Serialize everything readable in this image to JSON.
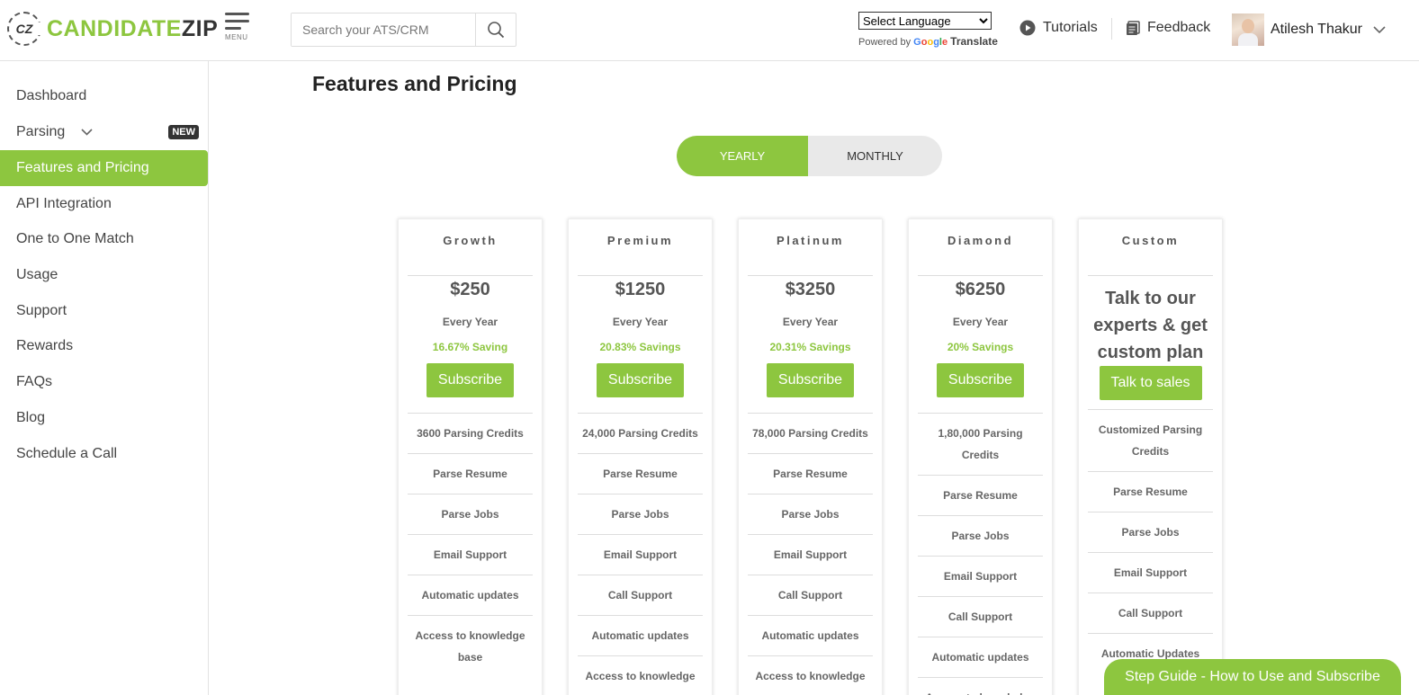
{
  "header": {
    "logo_text_1": "CANDIDATE",
    "logo_text_2": "ZIP",
    "logo_mark": "CZ",
    "menu_label": "MENU",
    "search_placeholder": "Search your ATS/CRM",
    "language_select": "Select Language",
    "powered_by": "Powered by",
    "google": "Google",
    "translate": "Translate",
    "tutorials": "Tutorials",
    "feedback": "Feedback",
    "user_name": "Atilesh Thakur"
  },
  "sidebar": {
    "items": [
      {
        "label": "Dashboard"
      },
      {
        "label": "Parsing",
        "badge": "NEW"
      },
      {
        "label": "Features and Pricing"
      },
      {
        "label": "API Integration"
      },
      {
        "label": "One to One Match"
      },
      {
        "label": "Usage"
      },
      {
        "label": "Support"
      },
      {
        "label": "Rewards"
      },
      {
        "label": "FAQs"
      },
      {
        "label": "Blog"
      },
      {
        "label": "Schedule a Call"
      }
    ]
  },
  "main": {
    "title": "Features and Pricing",
    "toggle": {
      "yearly": "YEARLY",
      "monthly": "MONTHLY"
    },
    "plans": [
      {
        "name": "Growth",
        "price": "$250",
        "period": "Every Year",
        "saving": "16.67% Saving",
        "button": "Subscribe",
        "features": [
          "3600 Parsing Credits",
          "Parse Resume",
          "Parse Jobs",
          "Email Support",
          "Automatic updates",
          "Access to knowledge base"
        ]
      },
      {
        "name": "Premium",
        "price": "$1250",
        "period": "Every Year",
        "saving": "20.83% Savings",
        "button": "Subscribe",
        "features": [
          "24,000 Parsing Credits",
          "Parse Resume",
          "Parse Jobs",
          "Email Support",
          "Call Support",
          "Automatic updates",
          "Access to knowledge"
        ]
      },
      {
        "name": "Platinum",
        "price": "$3250",
        "period": "Every Year",
        "saving": "20.31% Savings",
        "button": "Subscribe",
        "features": [
          "78,000 Parsing Credits",
          "Parse Resume",
          "Parse Jobs",
          "Email Support",
          "Call Support",
          "Automatic updates",
          "Access to knowledge"
        ]
      },
      {
        "name": "Diamond",
        "price": "$6250",
        "period": "Every Year",
        "saving": "20% Savings",
        "button": "Subscribe",
        "features": [
          "1,80,000 Parsing Credits",
          "Parse Resume",
          "Parse Jobs",
          "Email Support",
          "Call Support",
          "Automatic updates",
          "Access to knowledge"
        ]
      },
      {
        "name": "Custom",
        "custom_text": "Talk to our experts & get custom plan",
        "button": "Talk to sales",
        "features": [
          "Customized Parsing Credits",
          "Parse Resume",
          "Parse Jobs",
          "Email Support",
          "Call Support",
          "Automatic Updates"
        ]
      }
    ],
    "step_guide": "Step Guide - How to Use and Subscribe"
  },
  "colors": {
    "accent": "#8dc63f",
    "badge": "#333333"
  }
}
